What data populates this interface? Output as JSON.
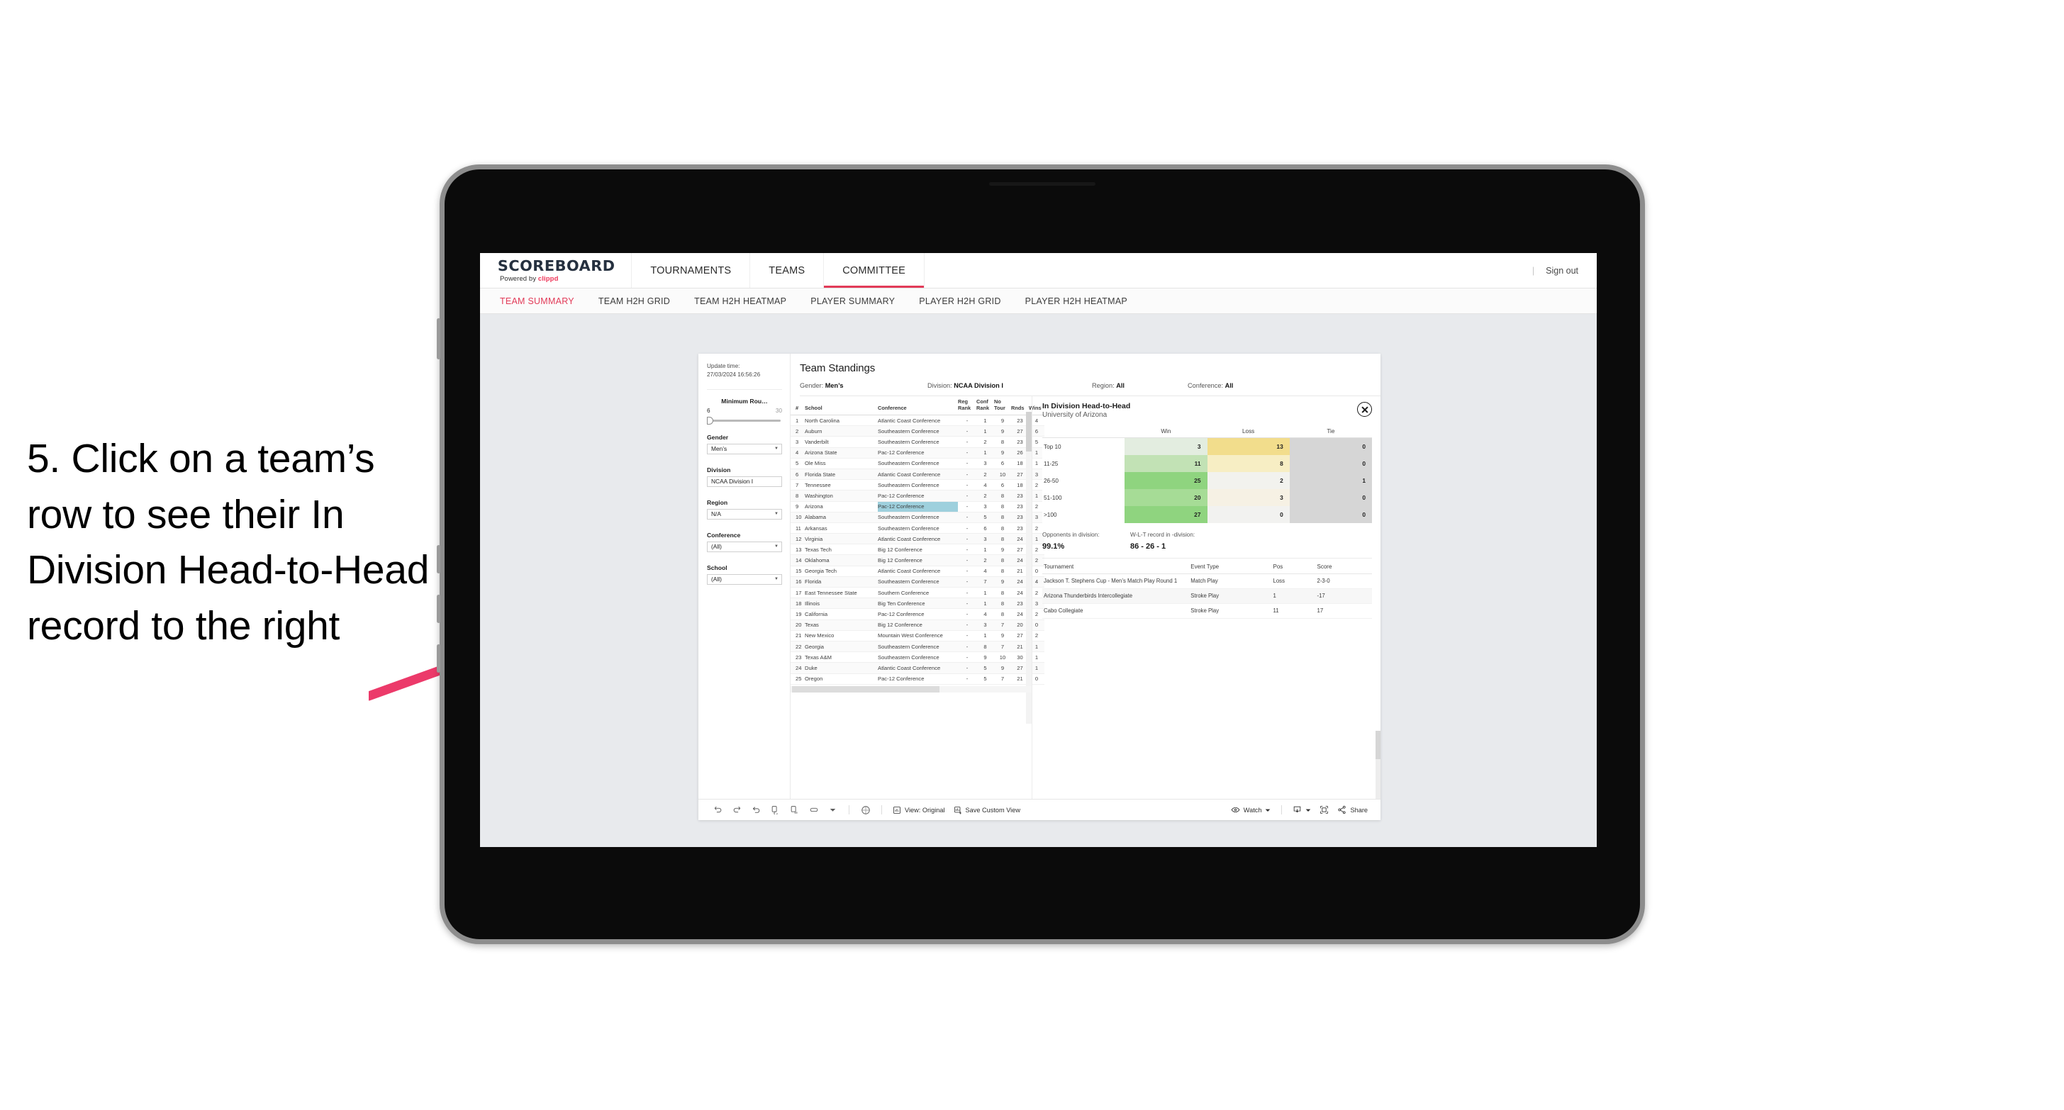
{
  "annotation": {
    "text": "5. Click on a team’s row to see their In Division Head-to-Head record to the right",
    "arrow_color": "#ec3a6a"
  },
  "topnav": {
    "logo_main": "SCOREBOARD",
    "logo_sub_prefix": "Powered by ",
    "logo_sub_brand": "clippd",
    "items": [
      {
        "label": "TOURNAMENTS",
        "active": false
      },
      {
        "label": "TEAMS",
        "active": false
      },
      {
        "label": "COMMITTEE",
        "active": true
      }
    ],
    "divider": "|",
    "sign_out": "Sign out"
  },
  "subnav": {
    "items": [
      {
        "label": "TEAM SUMMARY",
        "active": true
      },
      {
        "label": "TEAM H2H GRID",
        "active": false
      },
      {
        "label": "TEAM H2H HEATMAP",
        "active": false
      },
      {
        "label": "PLAYER SUMMARY",
        "active": false
      },
      {
        "label": "PLAYER H2H GRID",
        "active": false
      },
      {
        "label": "PLAYER H2H HEATMAP",
        "active": false
      }
    ]
  },
  "filters": {
    "update_time_label": "Update time:",
    "update_time_value": "27/03/2024 16:56:26",
    "slider": {
      "title": "Minimum Rou…",
      "low": "6",
      "high": "30"
    },
    "selects": [
      {
        "label": "Gender",
        "value": "Men’s"
      },
      {
        "label": "Division",
        "value": "NCAA Division I"
      },
      {
        "label": "Region",
        "value": "N/A"
      },
      {
        "label": "Conference",
        "value": "(All)"
      },
      {
        "label": "School",
        "value": "(All)"
      }
    ]
  },
  "main": {
    "title": "Team Standings",
    "sub_gender_label": "Gender: ",
    "sub_gender_value": "Men’s",
    "sub_division_label": "Division: ",
    "sub_division_value": "NCAA Division I",
    "sub_region_label": "Region: ",
    "sub_region_value": "All",
    "sub_conference_label": "Conference: ",
    "sub_conference_value": "All"
  },
  "standings": {
    "columns": [
      "#",
      "School",
      "Conference",
      "Reg Rank",
      "Conf Rank",
      "No Tour",
      "Rnds",
      "Wins"
    ],
    "columns_display": [
      {
        "l1": "#",
        "l2": ""
      },
      {
        "l1": "School",
        "l2": ""
      },
      {
        "l1": "Conference",
        "l2": ""
      },
      {
        "l1": "Reg",
        "l2": "Rank"
      },
      {
        "l1": "Conf",
        "l2": "Rank"
      },
      {
        "l1": "No",
        "l2": "Tour"
      },
      {
        "l1": "Rnds",
        "l2": ""
      },
      {
        "l1": "Wins",
        "l2": ""
      }
    ],
    "highlight_row": 9,
    "rows": [
      {
        "rank": "1",
        "school": "North Carolina",
        "conference": "Atlantic Coast Conference",
        "reg_rank": "-",
        "conf_rank": "1",
        "no_tour": "9",
        "rnds": "23",
        "wins": "4"
      },
      {
        "rank": "2",
        "school": "Auburn",
        "conference": "Southeastern Conference",
        "reg_rank": "-",
        "conf_rank": "1",
        "no_tour": "9",
        "rnds": "27",
        "wins": "6"
      },
      {
        "rank": "3",
        "school": "Vanderbilt",
        "conference": "Southeastern Conference",
        "reg_rank": "-",
        "conf_rank": "2",
        "no_tour": "8",
        "rnds": "23",
        "wins": "5"
      },
      {
        "rank": "4",
        "school": "Arizona State",
        "conference": "Pac-12 Conference",
        "reg_rank": "-",
        "conf_rank": "1",
        "no_tour": "9",
        "rnds": "26",
        "wins": "1"
      },
      {
        "rank": "5",
        "school": "Ole Miss",
        "conference": "Southeastern Conference",
        "reg_rank": "-",
        "conf_rank": "3",
        "no_tour": "6",
        "rnds": "18",
        "wins": "1"
      },
      {
        "rank": "6",
        "school": "Florida State",
        "conference": "Atlantic Coast Conference",
        "reg_rank": "-",
        "conf_rank": "2",
        "no_tour": "10",
        "rnds": "27",
        "wins": "3"
      },
      {
        "rank": "7",
        "school": "Tennessee",
        "conference": "Southeastern Conference",
        "reg_rank": "-",
        "conf_rank": "4",
        "no_tour": "6",
        "rnds": "18",
        "wins": "2"
      },
      {
        "rank": "8",
        "school": "Washington",
        "conference": "Pac-12 Conference",
        "reg_rank": "-",
        "conf_rank": "2",
        "no_tour": "8",
        "rnds": "23",
        "wins": "1"
      },
      {
        "rank": "9",
        "school": "Arizona",
        "conference": "Pac-12 Conference",
        "reg_rank": "-",
        "conf_rank": "3",
        "no_tour": "8",
        "rnds": "23",
        "wins": "2"
      },
      {
        "rank": "10",
        "school": "Alabama",
        "conference": "Southeastern Conference",
        "reg_rank": "-",
        "conf_rank": "5",
        "no_tour": "8",
        "rnds": "23",
        "wins": "3"
      },
      {
        "rank": "11",
        "school": "Arkansas",
        "conference": "Southeastern Conference",
        "reg_rank": "-",
        "conf_rank": "6",
        "no_tour": "8",
        "rnds": "23",
        "wins": "2"
      },
      {
        "rank": "12",
        "school": "Virginia",
        "conference": "Atlantic Coast Conference",
        "reg_rank": "-",
        "conf_rank": "3",
        "no_tour": "8",
        "rnds": "24",
        "wins": "1"
      },
      {
        "rank": "13",
        "school": "Texas Tech",
        "conference": "Big 12 Conference",
        "reg_rank": "-",
        "conf_rank": "1",
        "no_tour": "9",
        "rnds": "27",
        "wins": "2"
      },
      {
        "rank": "14",
        "school": "Oklahoma",
        "conference": "Big 12 Conference",
        "reg_rank": "-",
        "conf_rank": "2",
        "no_tour": "8",
        "rnds": "24",
        "wins": "2"
      },
      {
        "rank": "15",
        "school": "Georgia Tech",
        "conference": "Atlantic Coast Conference",
        "reg_rank": "-",
        "conf_rank": "4",
        "no_tour": "8",
        "rnds": "21",
        "wins": "0"
      },
      {
        "rank": "16",
        "school": "Florida",
        "conference": "Southeastern Conference",
        "reg_rank": "-",
        "conf_rank": "7",
        "no_tour": "9",
        "rnds": "24",
        "wins": "4"
      },
      {
        "rank": "17",
        "school": "East Tennessee State",
        "conference": "Southern Conference",
        "reg_rank": "-",
        "conf_rank": "1",
        "no_tour": "8",
        "rnds": "24",
        "wins": "2"
      },
      {
        "rank": "18",
        "school": "Illinois",
        "conference": "Big Ten Conference",
        "reg_rank": "-",
        "conf_rank": "1",
        "no_tour": "8",
        "rnds": "23",
        "wins": "3"
      },
      {
        "rank": "19",
        "school": "California",
        "conference": "Pac-12 Conference",
        "reg_rank": "-",
        "conf_rank": "4",
        "no_tour": "8",
        "rnds": "24",
        "wins": "2"
      },
      {
        "rank": "20",
        "school": "Texas",
        "conference": "Big 12 Conference",
        "reg_rank": "-",
        "conf_rank": "3",
        "no_tour": "7",
        "rnds": "20",
        "wins": "0"
      },
      {
        "rank": "21",
        "school": "New Mexico",
        "conference": "Mountain West Conference",
        "reg_rank": "-",
        "conf_rank": "1",
        "no_tour": "9",
        "rnds": "27",
        "wins": "2"
      },
      {
        "rank": "22",
        "school": "Georgia",
        "conference": "Southeastern Conference",
        "reg_rank": "-",
        "conf_rank": "8",
        "no_tour": "7",
        "rnds": "21",
        "wins": "1"
      },
      {
        "rank": "23",
        "school": "Texas A&M",
        "conference": "Southeastern Conference",
        "reg_rank": "-",
        "conf_rank": "9",
        "no_tour": "10",
        "rnds": "30",
        "wins": "1"
      },
      {
        "rank": "24",
        "school": "Duke",
        "conference": "Atlantic Coast Conference",
        "reg_rank": "-",
        "conf_rank": "5",
        "no_tour": "9",
        "rnds": "27",
        "wins": "1"
      },
      {
        "rank": "25",
        "school": "Oregon",
        "conference": "Pac-12 Conference",
        "reg_rank": "-",
        "conf_rank": "5",
        "no_tour": "7",
        "rnds": "21",
        "wins": "0"
      }
    ]
  },
  "h2h": {
    "title": "In Division Head-to-Head",
    "subtitle": "University of Arizona",
    "close_icon": "close-circle-icon",
    "matrix_columns": [
      "Win",
      "Loss",
      "Tie"
    ],
    "matrix_rows": [
      {
        "label": "Top 10",
        "win": "3",
        "loss": "13",
        "tie": "0",
        "win_color": "#e3ede0",
        "loss_color": "#f2dd8c",
        "tie_color": "#d6d6d6"
      },
      {
        "label": "11-25",
        "win": "11",
        "loss": "8",
        "tie": "0",
        "win_color": "#c2e2b5",
        "loss_color": "#f7eec4",
        "tie_color": "#d6d6d6"
      },
      {
        "label": "26-50",
        "win": "25",
        "loss": "2",
        "tie": "1",
        "win_color": "#8fd47f",
        "loss_color": "#f2f2ee",
        "tie_color": "#d6d6d6"
      },
      {
        "label": "51-100",
        "win": "20",
        "loss": "3",
        "tie": "0",
        "win_color": "#a6dc96",
        "loss_color": "#f6f1e4",
        "tie_color": "#d6d6d6"
      },
      {
        "label": ">100",
        "win": "27",
        "loss": "0",
        "tie": "0",
        "win_color": "#8fd47f",
        "loss_color": "#f2f2f0",
        "tie_color": "#d6d6d6"
      }
    ],
    "stats": [
      {
        "label": "Opponents in division:",
        "value": "99.1%"
      },
      {
        "label": "W-L-T record in -division:",
        "value": "86 - 26 - 1"
      }
    ],
    "tour_columns": [
      "Tournament",
      "Event Type",
      "Pos",
      "Score"
    ],
    "tour_rows": [
      {
        "name": "Jackson T. Stephens Cup - Men’s Match Play Round 1",
        "type": "Match Play",
        "pos": "Loss",
        "score": "2-3-0"
      },
      {
        "name": "Arizona Thunderbirds Intercollegiate",
        "type": "Stroke Play",
        "pos": "1",
        "score": "-17"
      },
      {
        "name": "Cabo Collegiate",
        "type": "Stroke Play",
        "pos": "11",
        "score": "17"
      }
    ]
  },
  "toolbar": {
    "icons": [
      "undo-icon",
      "redo-icon",
      "revert-icon",
      "refresh-data-icon",
      "pause-updates-icon",
      "highlight-icon",
      "caret-down-icon",
      "presentation-mode-icon"
    ],
    "view_label": "View: Original",
    "save_label": "Save Custom View",
    "watch_label": "Watch",
    "share_label": "Share",
    "download_icon": "download-icon",
    "fullscreen_icon": "fullscreen-icon",
    "share_icon": "share-icon",
    "eye_icon": "eye-icon",
    "view_icon": "view-chart-icon",
    "save_icon": "save-chart-icon"
  }
}
